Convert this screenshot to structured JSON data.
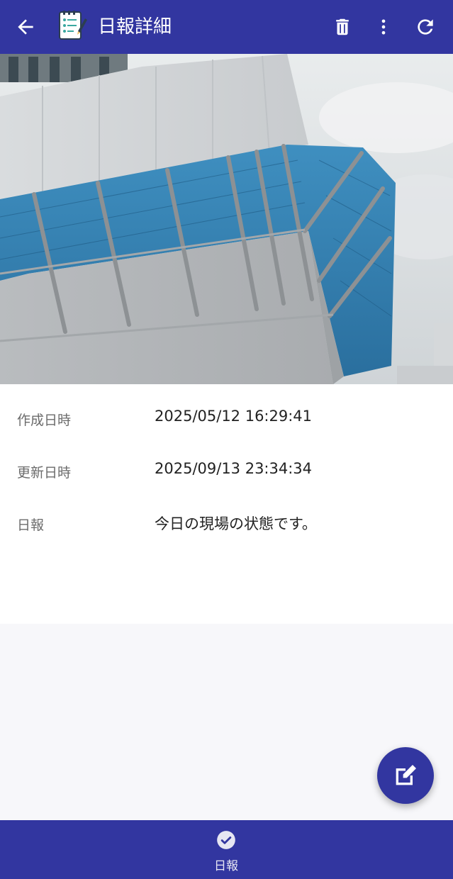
{
  "app_bar": {
    "title": "日報詳細",
    "icons": {
      "back": "arrow-back-icon",
      "logo": "report-notebook-icon",
      "delete": "trash-icon",
      "more": "more-vert-icon",
      "refresh": "refresh-icon"
    }
  },
  "photo": {
    "subject": "building-scaffolding-photo"
  },
  "details": {
    "rows": [
      {
        "label": "作成日時",
        "value": "2025/05/12 16:29:41"
      },
      {
        "label": "更新日時",
        "value": "2025/09/13 23:34:34"
      },
      {
        "label": "日報",
        "value": "今日の現場の状態です。"
      }
    ]
  },
  "fab": {
    "icon": "edit-icon"
  },
  "bottom_nav": {
    "items": [
      {
        "label": "日報",
        "icon": "check-circle-icon"
      }
    ]
  },
  "colors": {
    "primary": "#3236a0",
    "background": "#f7f7fa",
    "surface": "#ffffff"
  }
}
